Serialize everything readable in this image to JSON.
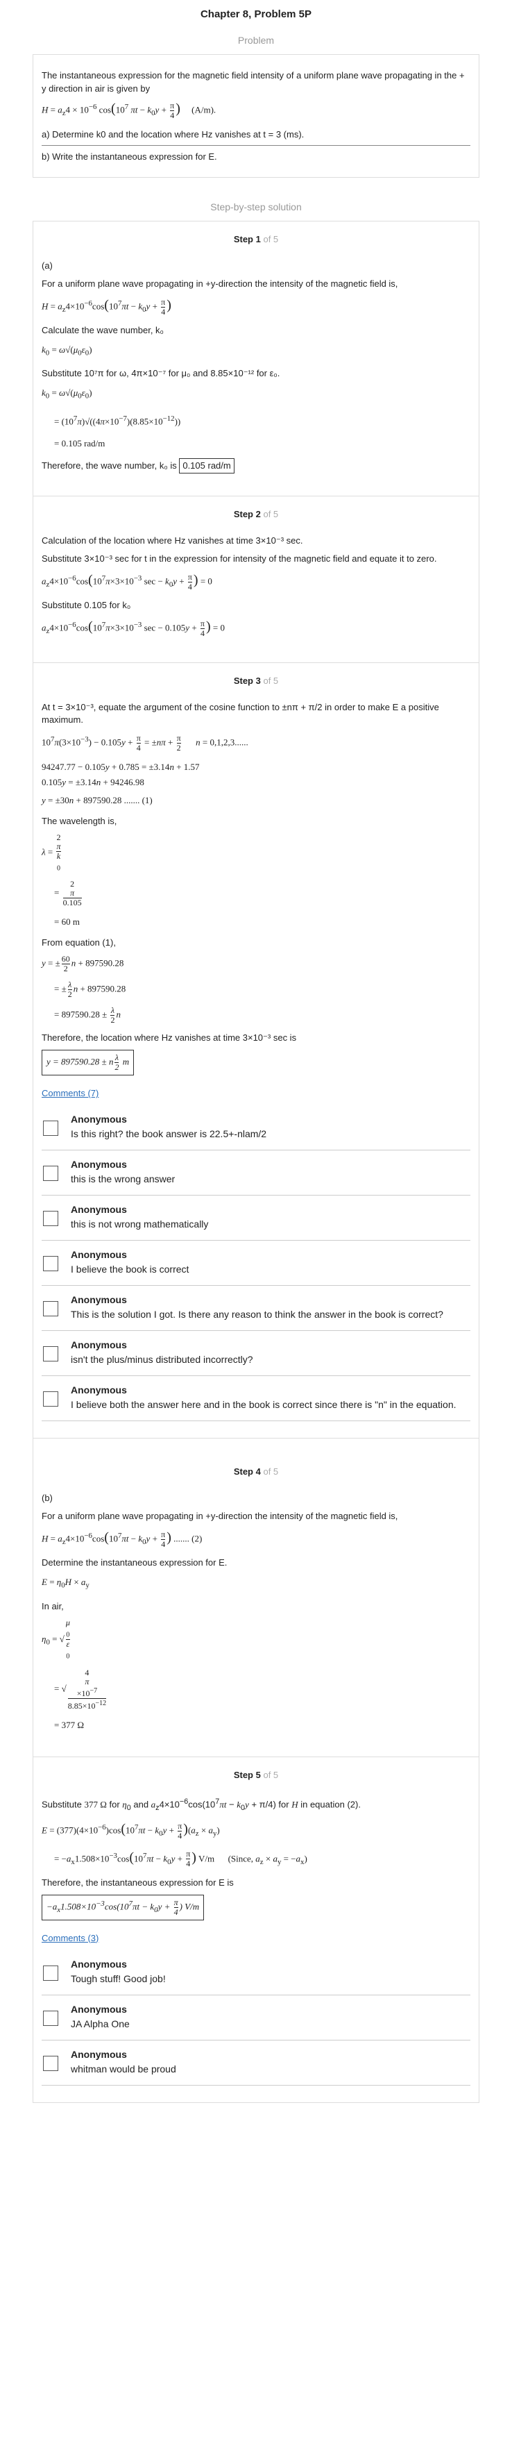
{
  "title": "Chapter 8, Problem 5P",
  "problem_heading": "Problem",
  "problem": {
    "line1": "The instantaneous expression for the magnetic field intensity of a uniform plane wave propagating in the + y direction in air is given by",
    "equation": "H = a_z 4 × 10⁻⁶ cos(10⁷ πt − k₀y + π/4)   (A/m).",
    "part_a": "a) Determine k0 and the location where Hz vanishes at t = 3 (ms).",
    "part_b": "b) Write the instantaneous expression for E."
  },
  "solution_heading": "Step-by-step solution",
  "steps": [
    {
      "label": "Step 1",
      "of": "of 5",
      "lines": [
        "(a)",
        "For a uniform plane wave propagating in +y-direction the intensity of the magnetic field is,",
        "Calculate the wave number,  k₀",
        "Substitute 10⁷π for ω, 4π×10⁻⁷ for μ₀ and 8.85×10⁻¹² for ε₀.",
        "Therefore, the wave number, k₀ is"
      ],
      "answer": "0.105 rad/m"
    },
    {
      "label": "Step 2",
      "of": "of 5",
      "lines": [
        "Calculation of the location where Hz vanishes at time 3×10⁻³ sec.",
        "Substitute 3×10⁻³ sec for t in the expression for intensity of the magnetic field and equate it to zero.",
        "Substitute 0.105 for k₀"
      ]
    },
    {
      "label": "Step 3",
      "of": "of 5",
      "lines": [
        "At t = 3×10⁻³, equate the argument of the cosine function to ±nπ + π/2 in order to make E a positive maximum.",
        "The wavelength is,",
        "From equation (1),",
        "Therefore, the location where Hz vanishes at time 3×10⁻³ sec is"
      ],
      "comments_link": "Comments (7)",
      "comments": [
        {
          "name": "Anonymous",
          "text": "Is this right? the book answer is 22.5+-nlam/2"
        },
        {
          "name": "Anonymous",
          "text": "this is the wrong answer"
        },
        {
          "name": "Anonymous",
          "text": "this is not wrong mathematically"
        },
        {
          "name": "Anonymous",
          "text": "I believe the book is correct"
        },
        {
          "name": "Anonymous",
          "text": "This is the solution I got. Is there any reason to think the answer in the book is correct?"
        },
        {
          "name": "Anonymous",
          "text": "isn't the plus/minus distributed incorrectly?"
        },
        {
          "name": "Anonymous",
          "text": "I believe both the answer here and in the book is correct since there is \"n\" in the equation."
        }
      ]
    },
    {
      "label": "Step 4",
      "of": "of 5",
      "lines": [
        "(b)",
        "For a uniform plane wave propagating in +y-direction the intensity of the magnetic field is,",
        "Determine the instantaneous expression for E.",
        "In air,"
      ]
    },
    {
      "label": "Step 5",
      "of": "of 5",
      "lines": [
        "Therefore, the instantaneous expression for E is"
      ],
      "comments_link": "Comments (3)",
      "comments": [
        {
          "name": "Anonymous",
          "text": "Tough stuff! Good job!"
        },
        {
          "name": "Anonymous",
          "text": "JA Alpha One"
        },
        {
          "name": "Anonymous",
          "text": "whitman would be proud"
        }
      ]
    }
  ]
}
